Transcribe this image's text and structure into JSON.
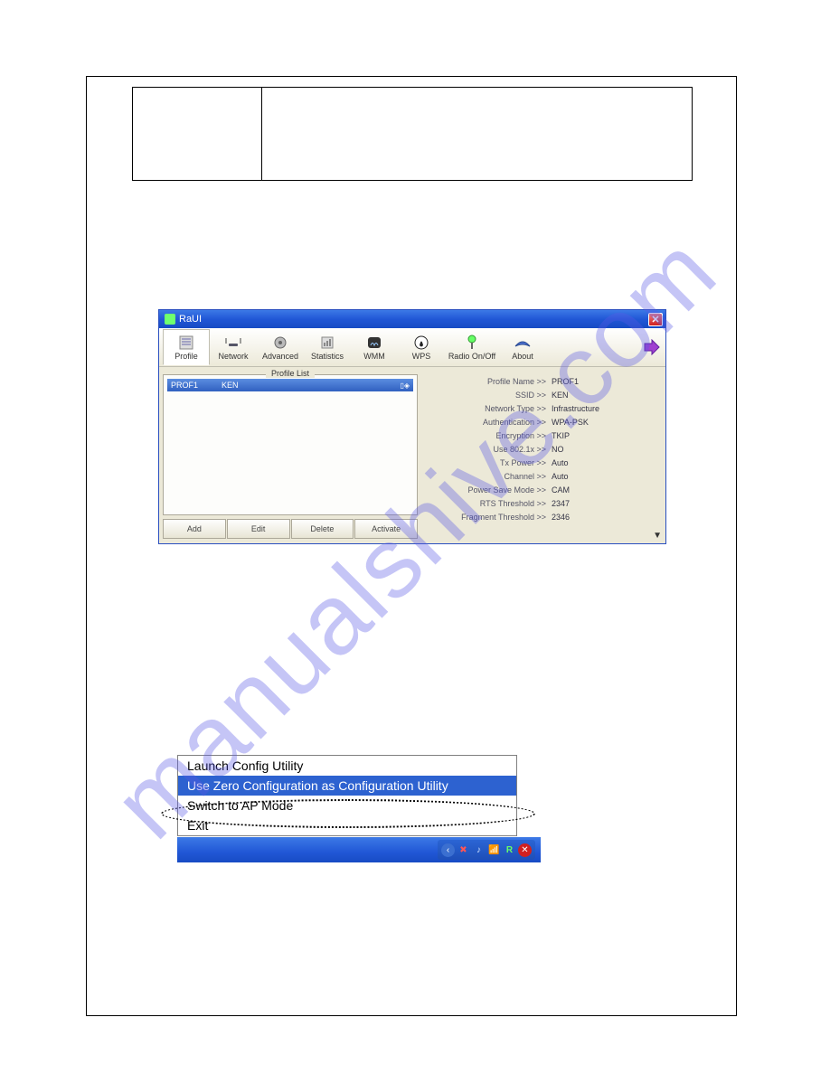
{
  "window": {
    "title": "RaUI",
    "toolbar": {
      "profile": "Profile",
      "network": "Network",
      "advanced": "Advanced",
      "statistics": "Statistics",
      "wmm": "WMM",
      "wps": "WPS",
      "radio": "Radio On/Off",
      "about": "About"
    },
    "profile_list": {
      "legend": "Profile List",
      "rows": [
        {
          "name": "PROF1",
          "ssid": "KEN"
        }
      ],
      "buttons": {
        "add": "Add",
        "edit": "Edit",
        "delete": "Delete",
        "activate": "Activate"
      }
    },
    "details": [
      {
        "label": "Profile Name >>",
        "value": "PROF1"
      },
      {
        "label": "SSID >>",
        "value": "KEN"
      },
      {
        "label": "Network Type >>",
        "value": "Infrastructure"
      },
      {
        "label": "Authentication >>",
        "value": "WPA-PSK"
      },
      {
        "label": "Encryption >>",
        "value": "TKIP"
      },
      {
        "label": "Use 802.1x >>",
        "value": "NO"
      },
      {
        "label": "Tx Power >>",
        "value": "Auto"
      },
      {
        "label": "Channel >>",
        "value": "Auto"
      },
      {
        "label": "Power Save Mode >>",
        "value": "CAM"
      },
      {
        "label": "RTS Threshold >>",
        "value": "2347"
      },
      {
        "label": "Fragment Threshold >>",
        "value": "2346"
      }
    ]
  },
  "context_menu": {
    "items": [
      {
        "label": "Launch Config Utility",
        "highlighted": false
      },
      {
        "label": "Use Zero Configuration as Configuration Utility",
        "highlighted": true
      },
      {
        "label": "Switch to AP Mode",
        "highlighted": false
      },
      {
        "label": "Exit",
        "highlighted": false
      }
    ]
  },
  "watermark": "manualshive.com"
}
